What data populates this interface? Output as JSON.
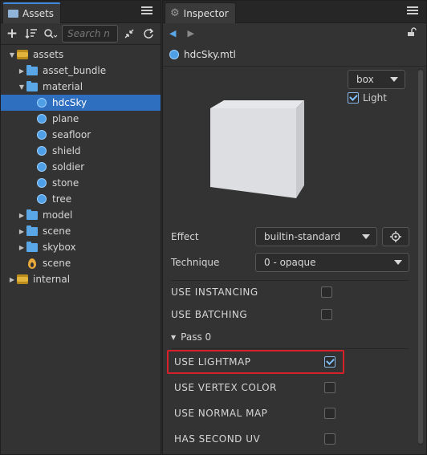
{
  "assets": {
    "tab_label": "Assets",
    "search_placeholder": "Search n",
    "tree": [
      {
        "label": "assets",
        "type": "db",
        "expanded": true,
        "depth": 0
      },
      {
        "label": "asset_bundle",
        "type": "folder",
        "expanded": false,
        "depth": 1
      },
      {
        "label": "material",
        "type": "folder",
        "expanded": true,
        "depth": 1
      },
      {
        "label": "hdcSky",
        "type": "material",
        "depth": 2,
        "selected": true
      },
      {
        "label": "plane",
        "type": "material",
        "depth": 2
      },
      {
        "label": "seafloor",
        "type": "material",
        "depth": 2
      },
      {
        "label": "shield",
        "type": "material",
        "depth": 2
      },
      {
        "label": "soldier",
        "type": "material",
        "depth": 2
      },
      {
        "label": "stone",
        "type": "material",
        "depth": 2
      },
      {
        "label": "tree",
        "type": "material",
        "depth": 2
      },
      {
        "label": "model",
        "type": "folder",
        "expanded": false,
        "depth": 1
      },
      {
        "label": "scene",
        "type": "folder",
        "expanded": false,
        "depth": 1
      },
      {
        "label": "skybox",
        "type": "folder",
        "expanded": false,
        "depth": 1
      },
      {
        "label": "scene",
        "type": "scene",
        "depth": 1
      },
      {
        "label": "internal",
        "type": "db",
        "expanded": false,
        "depth": 0
      }
    ]
  },
  "inspector": {
    "tab_label": "Inspector",
    "file_name": "hdcSky.mtl",
    "preview_shape": "box",
    "light_label": "Light",
    "light_checked": true,
    "effect_label": "Effect",
    "effect_value": "builtin-standard",
    "technique_label": "Technique",
    "technique_value": "0 - opaque",
    "use_instancing_label": "USE  INSTANCING",
    "use_batching_label": "USE  BATCHING",
    "pass_label": "Pass 0",
    "use_lightmap_label": "USE  LIGHTMAP",
    "use_vertex_color_label": "USE  VERTEX  COLOR",
    "use_normal_map_label": "USE  NORMAL  MAP",
    "has_second_uv_label": "HAS  SECOND  UV",
    "use_lightmap_checked": true
  },
  "colors": {
    "accent": "#3f8cdf",
    "selection": "#2f6fc0",
    "highlight_box": "#d8202a"
  }
}
